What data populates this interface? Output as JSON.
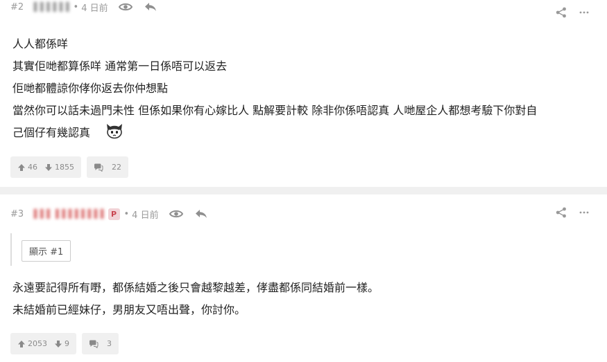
{
  "posts": [
    {
      "num": "#2",
      "user": "▐▐▐▐▐▐",
      "dot": "•",
      "date": "4 日前",
      "body": [
        "人人都係咩",
        "其實佢哋都算係咩 通常第一日係唔可以返去",
        "佢哋都體諒你侾你返去你仲想點",
        "當然你可以話未過門未性 但係如果你有心嫁比人 點解要計較 除非你係唔認真 人哋屋企人都想考驗下你對自",
        "己個仔有幾認真"
      ],
      "upvotes": "46",
      "downvotes": "1855",
      "replies": "22"
    },
    {
      "num": "#3",
      "user": "▐▐▐ ▐▐▐▐▐▐▐▐",
      "badge": "P",
      "dot": "•",
      "date": "4 日前",
      "quote_button": "顯示 #1",
      "body": [
        "永遠要記得所有嘢，都係結婚之後只會越黎越差，侾盡都係同結婚前一樣。",
        "未結婚前已經妹仔，男朋友又唔出聲，你討你。"
      ],
      "upvotes": "2053",
      "downvotes": "9",
      "replies": "3"
    }
  ],
  "icons": {
    "view": "eye-icon",
    "reply": "reply-icon",
    "share": "share-icon",
    "more": "more-icon",
    "upvote": "thumb-up-arrow-icon",
    "downvote": "thumb-down-arrow-icon",
    "comment": "comment-bubble-icon"
  },
  "colors": {
    "badge_bg": "#f2d3d7",
    "badge_text": "#c9444f",
    "muted": "#9a9a9a",
    "pill_bg": "#f0f0f0"
  }
}
